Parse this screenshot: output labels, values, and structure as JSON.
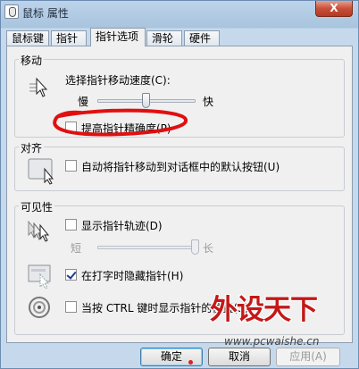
{
  "window": {
    "title": "鼠标 属性",
    "close_glyph": "X"
  },
  "tabs": [
    {
      "label": "鼠标键",
      "active": false
    },
    {
      "label": "指针",
      "active": false
    },
    {
      "label": "指针选项",
      "active": true
    },
    {
      "label": "滑轮",
      "active": false
    },
    {
      "label": "硬件",
      "active": false
    }
  ],
  "motion": {
    "group_label": "移动",
    "speed_label": "选择指针移动速度(C):",
    "slow_label": "慢",
    "fast_label": "快",
    "speed_level": 0.5,
    "precision_label": "提高指针精确度(P)",
    "precision_checked": false
  },
  "snap": {
    "group_label": "对齐",
    "label": "自动将指针移动到对话框中的默认按钮(U)",
    "checked": false
  },
  "visibility": {
    "group_label": "可见性",
    "trails_label": "显示指针轨迹(D)",
    "trails_checked": false,
    "short_label": "短",
    "long_label": "长",
    "trails_level": 1.0,
    "hide_label": "在打字时隐藏指针(H)",
    "hide_checked": true,
    "ctrl_label": "当按 CTRL 键时显示指针的位置(S)",
    "ctrl_checked": false
  },
  "buttons": {
    "ok": "确定",
    "cancel": "取消",
    "apply": "应用(A)"
  },
  "watermark": {
    "text": "外设天下",
    "url": "www.pcwaishe.cn"
  },
  "colors": {
    "annotation_red": "#e01010",
    "watermark_red": "#c41818"
  }
}
